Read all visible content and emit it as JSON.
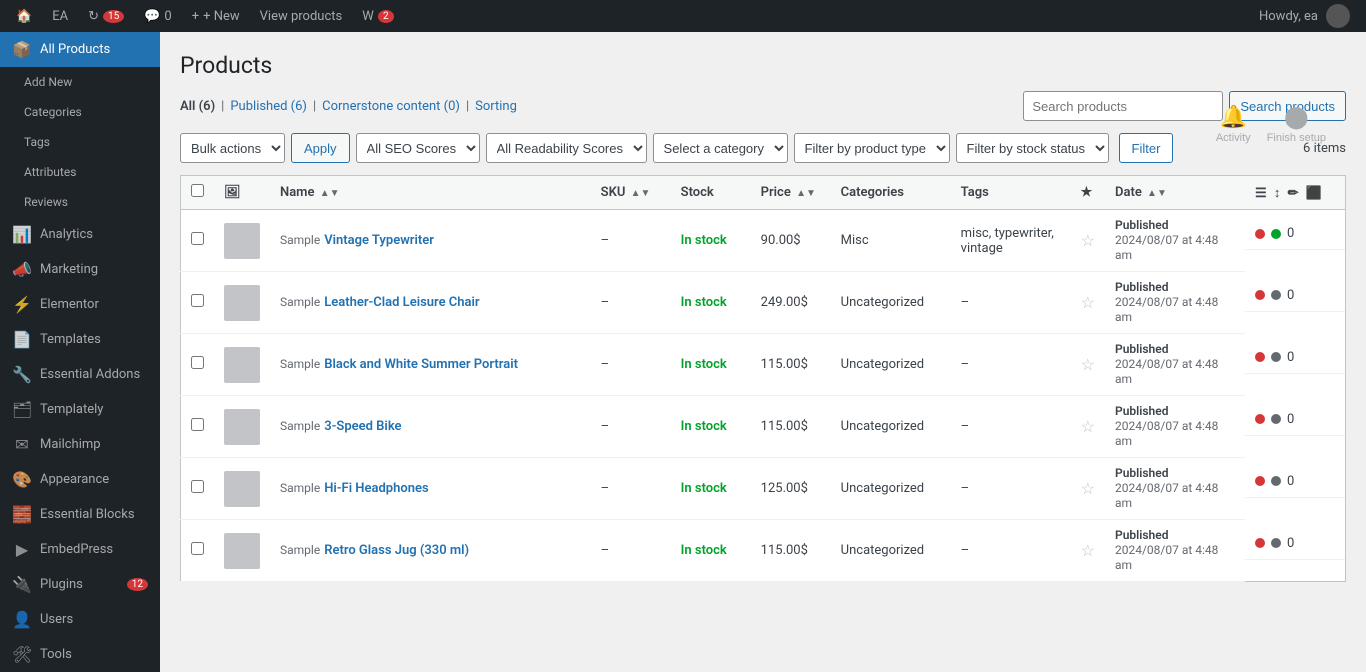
{
  "adminbar": {
    "site_icon": "🏠",
    "site_name": "EA",
    "updates_count": "15",
    "comments_count": "0",
    "new_label": "+ New",
    "view_products_label": "View products",
    "woo_icon": "W",
    "woo_badge": "2",
    "howdy_label": "Howdy, ea"
  },
  "sidebar": {
    "items": [
      {
        "id": "all-products",
        "label": "All Products",
        "icon": "📦",
        "active": true,
        "sub": false
      },
      {
        "id": "add-new",
        "label": "Add New",
        "icon": "",
        "active": false,
        "sub": true
      },
      {
        "id": "categories",
        "label": "Categories",
        "icon": "",
        "active": false,
        "sub": true
      },
      {
        "id": "tags",
        "label": "Tags",
        "icon": "",
        "active": false,
        "sub": true
      },
      {
        "id": "attributes",
        "label": "Attributes",
        "icon": "",
        "active": false,
        "sub": true
      },
      {
        "id": "reviews",
        "label": "Reviews",
        "icon": "",
        "active": false,
        "sub": true
      },
      {
        "id": "analytics",
        "label": "Analytics",
        "icon": "📊",
        "active": false,
        "sub": false
      },
      {
        "id": "marketing",
        "label": "Marketing",
        "icon": "📣",
        "active": false,
        "sub": false
      },
      {
        "id": "elementor",
        "label": "Elementor",
        "icon": "⚡",
        "active": false,
        "sub": false
      },
      {
        "id": "templates",
        "label": "Templates",
        "icon": "📄",
        "active": false,
        "sub": false
      },
      {
        "id": "essential-addons",
        "label": "Essential Addons",
        "icon": "🔧",
        "active": false,
        "sub": false
      },
      {
        "id": "templately",
        "label": "Templately",
        "icon": "🗂",
        "active": false,
        "sub": false
      },
      {
        "id": "mailchimp",
        "label": "Mailchimp",
        "icon": "✉",
        "active": false,
        "sub": false
      },
      {
        "id": "appearance",
        "label": "Appearance",
        "icon": "🎨",
        "active": false,
        "sub": false
      },
      {
        "id": "essential-blocks",
        "label": "Essential Blocks",
        "icon": "🧱",
        "active": false,
        "sub": false
      },
      {
        "id": "embedpress",
        "label": "EmbedPress",
        "icon": "▶",
        "active": false,
        "sub": false
      },
      {
        "id": "plugins",
        "label": "Plugins",
        "icon": "🔌",
        "active": false,
        "sub": false,
        "badge": "12"
      },
      {
        "id": "users",
        "label": "Users",
        "icon": "👤",
        "active": false,
        "sub": false
      },
      {
        "id": "tools",
        "label": "Tools",
        "icon": "🛠",
        "active": false,
        "sub": false
      }
    ]
  },
  "top_actions": {
    "activity_label": "Activity",
    "finish_setup_label": "Finish setup"
  },
  "page": {
    "title": "Products"
  },
  "tabs": [
    {
      "id": "all",
      "label": "All (6)",
      "active": true
    },
    {
      "id": "published",
      "label": "Published (6)",
      "active": false
    },
    {
      "id": "cornerstone",
      "label": "Cornerstone content (0)",
      "active": false
    },
    {
      "id": "sorting",
      "label": "Sorting",
      "active": false
    }
  ],
  "toolbar": {
    "bulk_actions_label": "Bulk actions",
    "apply_label": "Apply",
    "seo_scores_label": "All SEO Scores",
    "readability_label": "All Readability Scores",
    "category_label": "Select a category",
    "product_type_label": "Filter by product type",
    "stock_status_label": "Filter by stock status",
    "filter_label": "Filter",
    "items_count": "6 items",
    "search_placeholder": "Search products",
    "search_btn_label": "Search products"
  },
  "table": {
    "columns": [
      {
        "id": "name",
        "label": "Name",
        "sortable": true
      },
      {
        "id": "sku",
        "label": "SKU",
        "sortable": true
      },
      {
        "id": "stock",
        "label": "Stock",
        "sortable": false
      },
      {
        "id": "price",
        "label": "Price",
        "sortable": true
      },
      {
        "id": "categories",
        "label": "Categories",
        "sortable": false
      },
      {
        "id": "tags",
        "label": "Tags",
        "sortable": false
      },
      {
        "id": "featured",
        "label": "★",
        "sortable": false
      },
      {
        "id": "date",
        "label": "Date",
        "sortable": true
      }
    ],
    "rows": [
      {
        "id": 1,
        "sample": "Sample",
        "name": "Vintage Typewriter",
        "sku": "–",
        "stock": "In stock",
        "price": "90.00$",
        "categories": "Misc",
        "tags": "misc, typewriter, vintage",
        "date_status": "Published",
        "date": "2024/08/07 at 4:48 am",
        "dot1": "red",
        "dot2": "green",
        "count": "0"
      },
      {
        "id": 2,
        "sample": "Sample",
        "name": "Leather-Clad Leisure Chair",
        "sku": "–",
        "stock": "In stock",
        "price": "249.00$",
        "categories": "Uncategorized",
        "tags": "–",
        "date_status": "Published",
        "date": "2024/08/07 at 4:48 am",
        "dot1": "red",
        "dot2": "gray",
        "count": "0"
      },
      {
        "id": 3,
        "sample": "Sample",
        "name": "Black and White Summer Portrait",
        "sku": "–",
        "stock": "In stock",
        "price": "115.00$",
        "categories": "Uncategorized",
        "tags": "–",
        "date_status": "Published",
        "date": "2024/08/07 at 4:48 am",
        "dot1": "red",
        "dot2": "gray",
        "count": "0"
      },
      {
        "id": 4,
        "sample": "Sample",
        "name": "3-Speed Bike",
        "sku": "–",
        "stock": "In stock",
        "price": "115.00$",
        "categories": "Uncategorized",
        "tags": "–",
        "date_status": "Published",
        "date": "2024/08/07 at 4:48 am",
        "dot1": "red",
        "dot2": "gray",
        "count": "0"
      },
      {
        "id": 5,
        "sample": "Sample",
        "name": "Hi-Fi Headphones",
        "sku": "–",
        "stock": "In stock",
        "price": "125.00$",
        "categories": "Uncategorized",
        "tags": "–",
        "date_status": "Published",
        "date": "2024/08/07 at 4:48 am",
        "dot1": "red",
        "dot2": "gray",
        "count": "0"
      },
      {
        "id": 6,
        "sample": "Sample",
        "name": "Retro Glass Jug (330 ml)",
        "sku": "–",
        "stock": "In stock",
        "price": "115.00$",
        "categories": "Uncategorized",
        "tags": "–",
        "date_status": "Published",
        "date": "2024/08/07 at 4:48 am",
        "dot1": "red",
        "dot2": "gray",
        "count": "0"
      }
    ]
  }
}
